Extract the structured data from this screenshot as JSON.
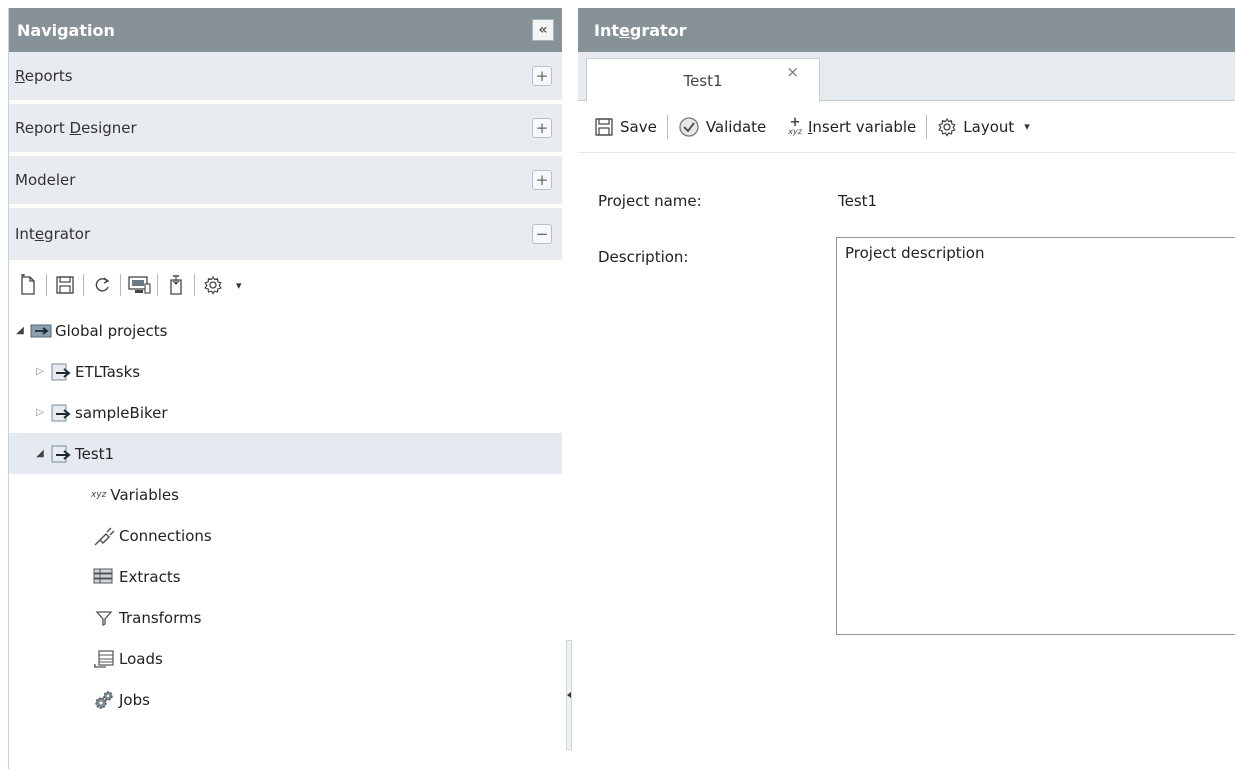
{
  "navigation": {
    "title": "Navigation",
    "collapse_glyph": "«",
    "sections": [
      {
        "pre": "",
        "key": "R",
        "post": "eports",
        "toggle": "+"
      },
      {
        "pre": "Report ",
        "key": "D",
        "post": "esigner",
        "toggle": "+"
      },
      {
        "pre": "Modeler",
        "key": "",
        "post": "",
        "toggle": "+"
      },
      {
        "pre": "Int",
        "key": "e",
        "post": "grator",
        "toggle": "−"
      }
    ],
    "toolbar_caret": "▾",
    "tree": {
      "root": {
        "label": "Global projects",
        "expander": "◢"
      },
      "projects": [
        {
          "label": "ETLTasks",
          "expander": "▷"
        },
        {
          "label": "sampleBiker",
          "expander": "▷"
        },
        {
          "label": "Test1",
          "expander": "◢"
        }
      ],
      "children": [
        {
          "label": "Variables",
          "icon": "variables-icon",
          "prefix": "xyz"
        },
        {
          "label": "Connections",
          "icon": "connections-icon",
          "prefix": ""
        },
        {
          "label": "Extracts",
          "icon": "extracts-icon",
          "prefix": ""
        },
        {
          "label": "Transforms",
          "icon": "transforms-icon",
          "prefix": ""
        },
        {
          "label": "Loads",
          "icon": "loads-icon",
          "prefix": ""
        },
        {
          "label": "Jobs",
          "icon": "jobs-icon",
          "prefix": ""
        }
      ]
    }
  },
  "integrator": {
    "title_pre": "Int",
    "title_key": "e",
    "title_post": "grator",
    "tab": {
      "label": "Test1",
      "close": "×"
    },
    "toolbar": {
      "save": "Save",
      "validate": "Validate",
      "insert_key": "I",
      "insert_rest": "nsert variable",
      "insert_prefix": "xyz",
      "layout": "Layout",
      "caret": "▾"
    },
    "form": {
      "project_name_label": "Project name:",
      "project_name_value": "Test1",
      "description_label": "Description:",
      "description_value": "Project description"
    }
  },
  "colors": {
    "header_bg": "#869298",
    "section_bg": "#e8ecf0",
    "selected_bg": "#e4eaf0"
  }
}
